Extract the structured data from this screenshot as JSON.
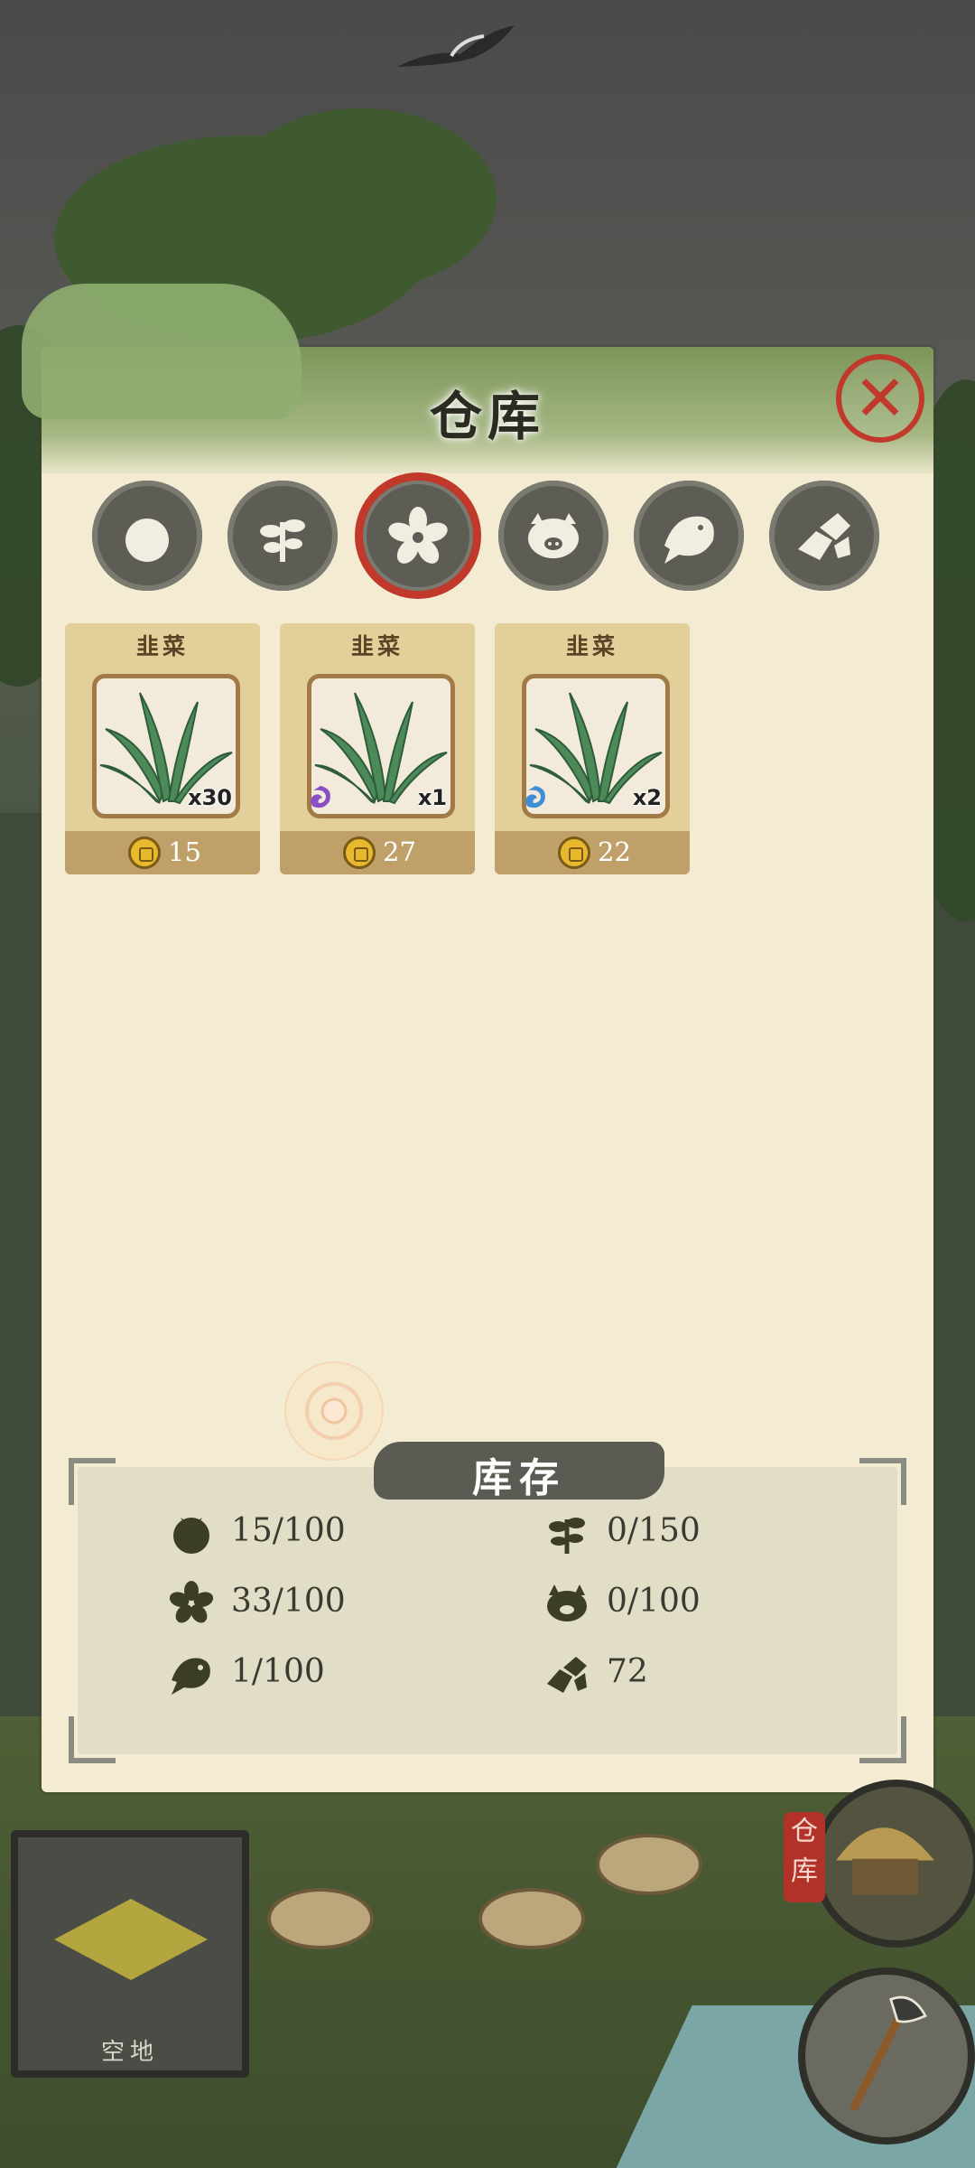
{
  "panel": {
    "title": "仓库",
    "close_symbol": "✕"
  },
  "tabs": [
    {
      "icon": "tomato-icon",
      "active": false
    },
    {
      "icon": "sprout-icon",
      "active": false
    },
    {
      "icon": "flower-icon",
      "active": true
    },
    {
      "icon": "pig-icon",
      "active": false
    },
    {
      "icon": "fish-icon",
      "active": false
    },
    {
      "icon": "stone-icon",
      "active": false
    }
  ],
  "items": [
    {
      "name": "韭菜",
      "quantity": "x30",
      "price": "15",
      "quality": "none"
    },
    {
      "name": "韭菜",
      "quantity": "x1",
      "price": "27",
      "quality": "purple"
    },
    {
      "name": "韭菜",
      "quantity": "x2",
      "price": "22",
      "quality": "blue"
    }
  ],
  "stock": {
    "title": "库存",
    "rows": [
      {
        "icon": "tomato-icon",
        "value": "15/100"
      },
      {
        "icon": "sprout-icon",
        "value": "0/150"
      },
      {
        "icon": "flower-icon",
        "value": "33/100"
      },
      {
        "icon": "pig-icon",
        "value": "0/100"
      },
      {
        "icon": "fish-icon",
        "value": "1/100"
      },
      {
        "icon": "stone-icon",
        "value": "72"
      }
    ]
  },
  "hud": {
    "plot_label": "空地",
    "warehouse_tag": "仓库"
  },
  "colors": {
    "accent_red": "#c0392b",
    "header_green": "#7c955a",
    "panel_bg": "#f3ecd3",
    "card_bg": "#e3cf9a"
  }
}
